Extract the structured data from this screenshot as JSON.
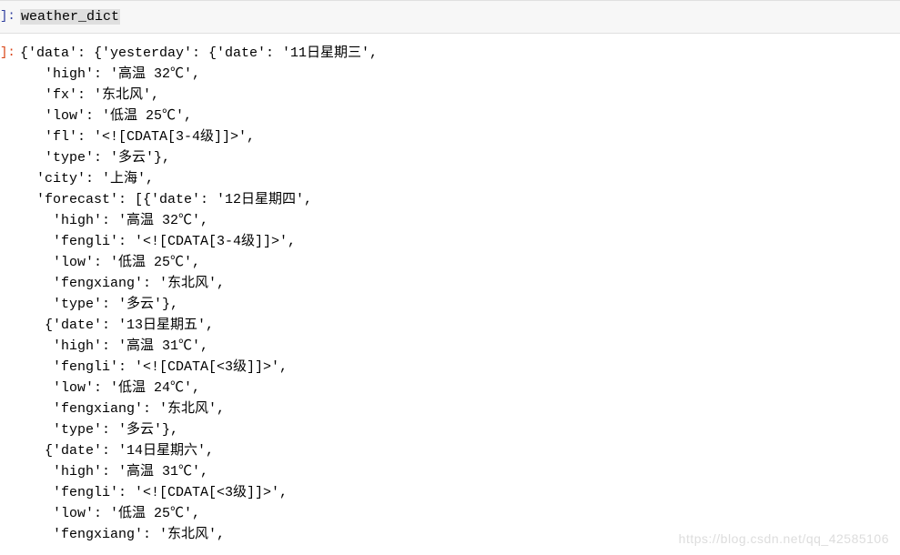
{
  "input": {
    "prompt": "]:",
    "code": "weather_dict"
  },
  "output": {
    "prompt": "]:",
    "lines": [
      "{'data': {'yesterday': {'date': '11日星期三',",
      "   'high': '高温 32℃',",
      "   'fx': '东北风',",
      "   'low': '低温 25℃',",
      "   'fl': '<![CDATA[3-4级]]>',",
      "   'type': '多云'},",
      "  'city': '上海',",
      "  'forecast': [{'date': '12日星期四',",
      "    'high': '高温 32℃',",
      "    'fengli': '<![CDATA[3-4级]]>',",
      "    'low': '低温 25℃',",
      "    'fengxiang': '东北风',",
      "    'type': '多云'},",
      "   {'date': '13日星期五',",
      "    'high': '高温 31℃',",
      "    'fengli': '<![CDATA[<3级]]>',",
      "    'low': '低温 24℃',",
      "    'fengxiang': '东北风',",
      "    'type': '多云'},",
      "   {'date': '14日星期六',",
      "    'high': '高温 31℃',",
      "    'fengli': '<![CDATA[<3级]]>',",
      "    'low': '低温 25℃',",
      "    'fengxiang': '东北风',"
    ]
  },
  "watermark": "https://blog.csdn.net/qq_42585106"
}
